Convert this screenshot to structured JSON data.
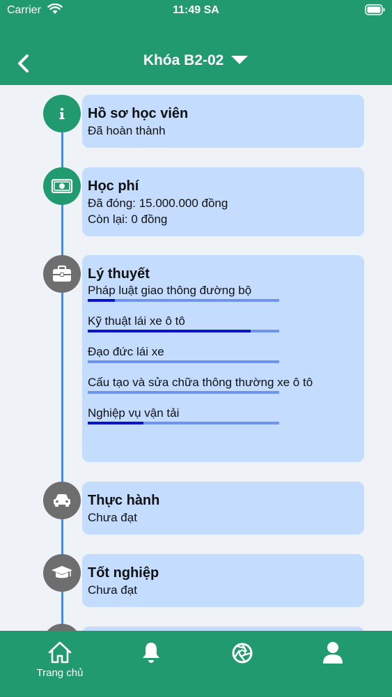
{
  "status_bar": {
    "carrier": "Carrier",
    "time": "11:49 SA"
  },
  "nav": {
    "title": "Khóa B2-02"
  },
  "timeline": [
    {
      "title": "Hồ sơ học viên",
      "lines": [
        "Đã hoàn thành"
      ],
      "state": "done",
      "icon": "info-icon"
    },
    {
      "title": "Học phí",
      "lines": [
        "Đã đóng: 15.000.000 đồng",
        "Còn lại: 0 đồng"
      ],
      "state": "done",
      "icon": "money-icon"
    },
    {
      "title": "Lý thuyết",
      "state": "pending",
      "icon": "briefcase-icon",
      "subjects": [
        {
          "label": "Pháp luật giao thông đường bộ",
          "progress": 0.14
        },
        {
          "label": "Kỹ thuật lái xe ô tô",
          "progress": 0.85
        },
        {
          "label": "Đạo đức lái xe",
          "progress": 0.0
        },
        {
          "label": "Cấu tạo và sửa chữa thông thường xe ô tô",
          "progress": 0.0
        },
        {
          "label": "Nghiệp vụ vận tải",
          "progress": 0.29
        }
      ]
    },
    {
      "title": "Thực hành",
      "lines": [
        "Chưa đạt"
      ],
      "state": "pending",
      "icon": "car-icon"
    },
    {
      "title": "Tốt nghiệp",
      "lines": [
        "Chưa đạt"
      ],
      "state": "pending",
      "icon": "graduation-cap-icon"
    }
  ],
  "tabbar": [
    {
      "label": "Trang chủ",
      "icon": "home-icon"
    },
    {
      "label": "",
      "icon": "bell-icon"
    },
    {
      "label": "",
      "icon": "aperture-icon"
    },
    {
      "label": "",
      "icon": "user-icon"
    }
  ],
  "colors": {
    "primary": "#229a6f",
    "card": "#c4dcfd",
    "timeline": "#3d8ee6",
    "pending_node": "#6e6e6e",
    "progress_fill": "#0a14c9",
    "progress_track": "#7093ef"
  }
}
